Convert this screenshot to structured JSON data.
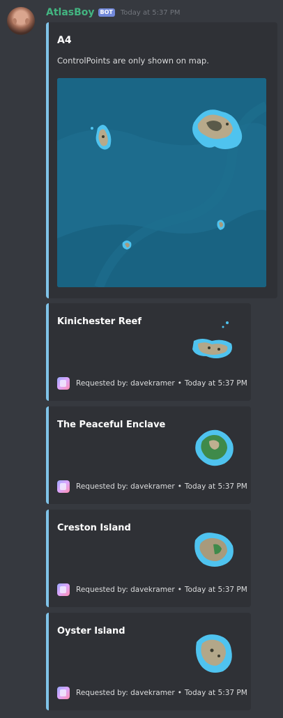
{
  "message": {
    "username": "AtlasBoy",
    "bot_tag": "BOT",
    "timestamp": "Today at 5:37 PM"
  },
  "main_embed": {
    "title": "A4",
    "description": "ControlPoints are only shown on map."
  },
  "island_embeds": [
    {
      "title": "Kinichester Reef",
      "footer": {
        "requested_by": "Requested by: davekramer",
        "separator": "•",
        "time": "Today at 5:37 PM"
      }
    },
    {
      "title": "The Peaceful Enclave",
      "footer": {
        "requested_by": "Requested by: davekramer",
        "separator": "•",
        "time": "Today at 5:37 PM"
      }
    },
    {
      "title": "Creston Island",
      "footer": {
        "requested_by": "Requested by: davekramer",
        "separator": "•",
        "time": "Today at 5:37 PM"
      }
    },
    {
      "title": "Oyster Island",
      "footer": {
        "requested_by": "Requested by: davekramer",
        "separator": "•",
        "time": "Today at 5:37 PM"
      }
    }
  ],
  "colors": {
    "background": "#36393f",
    "embed_background": "#2f3136",
    "embed_accent": "#7fc3e8",
    "username": "#43b581",
    "bot_tag": "#7289da",
    "ocean": "#1d6c8d",
    "shallow_water": "#3fc3f0"
  },
  "icons": {
    "avatar": "bot-avatar",
    "footer": "requester-avatar-icon"
  }
}
